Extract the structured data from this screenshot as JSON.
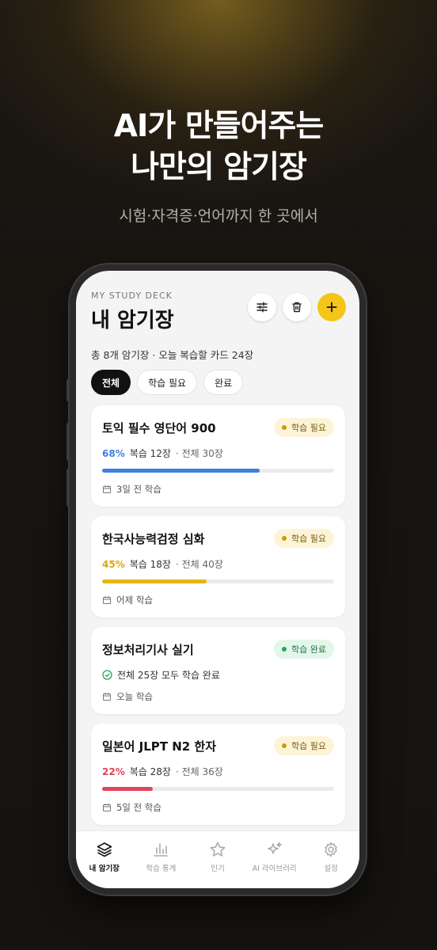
{
  "promo": {
    "headline_line1": "AI가 만들어주는",
    "headline_line2": "나만의 암기장",
    "subtitle": "시험·자격증·언어까지 한 곳에서"
  },
  "header": {
    "overline": "MY STUDY DECK",
    "title": "내 암기장",
    "summary": "총 8개 암기장 · 오늘 복습할 카드 24장"
  },
  "filters": {
    "all": "전체",
    "needs_study": "학습 필요",
    "done": "완료"
  },
  "decks": [
    {
      "title": "토익 필수 영단어 900",
      "badge": "학습 필요",
      "percent": "68%",
      "review": "복습 12장",
      "total": "· 전체 30장",
      "last": "3일 전 학습",
      "progress": 0.68,
      "color": "#3f7fe0"
    },
    {
      "title": "한국사능력검정 심화",
      "badge": "학습 필요",
      "percent": "45%",
      "review": "복습 18장",
      "total": "· 전체 40장",
      "last": "어제 학습",
      "progress": 0.45,
      "color": "#e5b414"
    },
    {
      "title": "정보처리기사 실기",
      "badge": "학습 완료",
      "complete_note": "전체 25장 모두 학습 완료",
      "last": "오늘 학습"
    },
    {
      "title": "일본어 JLPT N2 한자",
      "badge": "학습 필요",
      "percent": "22%",
      "review": "복습 28장",
      "total": "· 전체 36장",
      "last": "5일 전 학습",
      "progress": 0.22,
      "color": "#e0445a"
    }
  ],
  "tabbar": {
    "my_decks": "내 암기장",
    "stats": "학습 통계",
    "popular": "인기",
    "ai_library": "AI 라이브러리",
    "settings": "설정"
  },
  "colors": {
    "accent": "#f5c518",
    "complete": "#2aa55e"
  }
}
